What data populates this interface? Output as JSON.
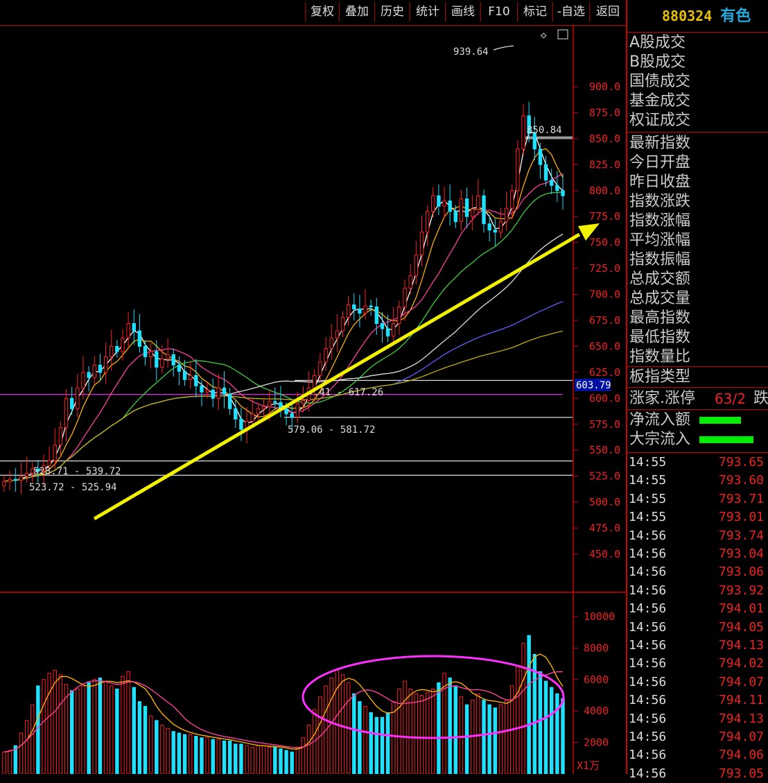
{
  "toolbar": {
    "buttons": [
      "复权",
      "叠加",
      "历史",
      "统计",
      "画线",
      "F10",
      "标记",
      "-自选",
      "返回"
    ]
  },
  "header": {
    "code": "880324",
    "name": "有色"
  },
  "stats": {
    "labels": [
      "A股成交",
      "B股成交",
      "国债成交",
      "基金成交",
      "权证成交",
      "最新指数",
      "今日开盘",
      "昨日收盘",
      "指数涨跌",
      "指数涨幅",
      "平均涨幅",
      "指数振幅",
      "总成交额",
      "总成交量",
      "最高指数",
      "最低指数",
      "指数量比",
      "板指类型"
    ],
    "ratio_label": "涨家.涨停",
    "ratio_value": "63/2",
    "ratio_next": "跌",
    "flow_label": "净流入额",
    "block_label": "大宗流入",
    "green": "#00e000"
  },
  "ticks": [
    {
      "time": "14:55",
      "price": "793.65"
    },
    {
      "time": "14:55",
      "price": "793.60"
    },
    {
      "time": "14:55",
      "price": "793.71"
    },
    {
      "time": "14:55",
      "price": "793.01"
    },
    {
      "time": "14:56",
      "price": "793.74"
    },
    {
      "time": "14:56",
      "price": "793.04"
    },
    {
      "time": "14:56",
      "price": "793.06"
    },
    {
      "time": "14:56",
      "price": "793.92"
    },
    {
      "time": "14:56",
      "price": "794.01"
    },
    {
      "time": "14:56",
      "price": "794.05"
    },
    {
      "time": "14:56",
      "price": "794.13"
    },
    {
      "time": "14:56",
      "price": "794.02"
    },
    {
      "time": "14:56",
      "price": "794.07"
    },
    {
      "time": "14:56",
      "price": "794.11"
    },
    {
      "time": "14:56",
      "price": "794.13"
    },
    {
      "time": "14:56",
      "price": "794.07"
    },
    {
      "time": "14:56",
      "price": "794.06"
    },
    {
      "time": "14:56",
      "price": "793.05"
    }
  ],
  "chart_data": {
    "type": "candlestick",
    "price_axis": {
      "ticks": [
        "900.0",
        "875.0",
        "850.0",
        "825.0",
        "800.0",
        "775.0",
        "750.0",
        "725.0",
        "700.0",
        "675.0",
        "650.0",
        "625.0",
        "600.0",
        "575.0",
        "550.0",
        "525.0",
        "500.0",
        "475.0",
        "450.0"
      ],
      "range": [
        445,
        945
      ]
    },
    "current_price_label": "603.79",
    "annotations": {
      "peak": "939.64",
      "peak_support": "850.84",
      "band_upper": ".41 - 617.26",
      "band_lower": "579.06 - 581.72",
      "band_a": "528.71 - 539.72",
      "band_b": "523.72 - 525.94"
    },
    "levels": [
      850.84,
      617.26,
      581.72,
      539.72,
      525.94,
      603.79
    ],
    "close": [
      520,
      522,
      521,
      525,
      528,
      532,
      530,
      535,
      540,
      555,
      572,
      600,
      590,
      610,
      625,
      620,
      632,
      625,
      640,
      650,
      645,
      658,
      672,
      665,
      650,
      640,
      645,
      630,
      638,
      642,
      632,
      626,
      618,
      622,
      612,
      606,
      608,
      600,
      610,
      604,
      590,
      580,
      570,
      578,
      585,
      590,
      592,
      597,
      596,
      590,
      585,
      582,
      595,
      598,
      610,
      622,
      635,
      648,
      658,
      665,
      678,
      690,
      686,
      682,
      689,
      688,
      672,
      667,
      660,
      672,
      688,
      706,
      718,
      738,
      760,
      780,
      795,
      785,
      790,
      780,
      770,
      792,
      775,
      782,
      795,
      768,
      762,
      760,
      770,
      783,
      800,
      840,
      872,
      855,
      840,
      825,
      810,
      805,
      800,
      795
    ],
    "volume_axis": {
      "ticks": [
        "10000",
        "8000",
        "6000",
        "4000",
        "2000"
      ],
      "range": [
        0,
        11000
      ],
      "unit": "X1万"
    },
    "volume": [
      1400,
      1500,
      1800,
      2600,
      3400,
      4400,
      5600,
      6000,
      6400,
      6600,
      6300,
      5700,
      5300,
      5400,
      5600,
      5800,
      6000,
      6100,
      5900,
      5600,
      5400,
      6200,
      6500,
      5500,
      4600,
      4300,
      3700,
      3400,
      3100,
      2900,
      2700,
      2600,
      2500,
      2500,
      2400,
      2300,
      2300,
      2200,
      2200,
      2100,
      2100,
      1900,
      1900,
      1800,
      1700,
      1800,
      1800,
      1700,
      1700,
      1600,
      1500,
      1400,
      1700,
      2300,
      3100,
      4100,
      4900,
      5600,
      6100,
      6600,
      6300,
      5800,
      5100,
      4600,
      4300,
      3900,
      3600,
      3600,
      3900,
      4600,
      5400,
      5900,
      5400,
      5100,
      5000,
      5200,
      5400,
      5800,
      6400,
      6100,
      5600,
      4900,
      4400,
      4700,
      5100,
      4700,
      4400,
      4200,
      4400,
      4700,
      5600,
      6900,
      8300,
      8800,
      7600,
      6500,
      5900,
      5500,
      5100,
      4800
    ]
  }
}
